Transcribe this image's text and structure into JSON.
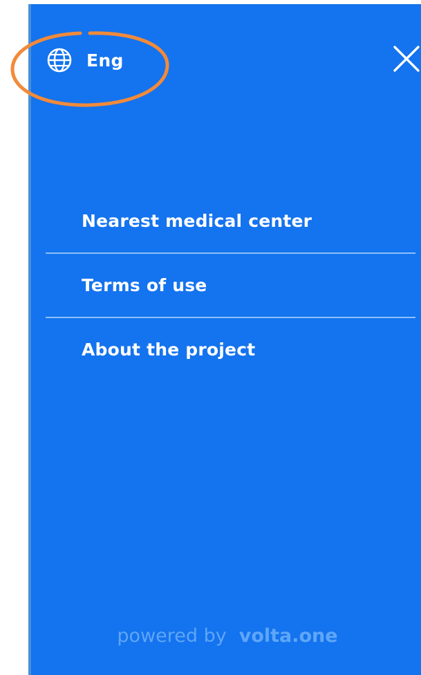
{
  "header": {
    "language_label": "Eng",
    "language_icon": "globe-icon",
    "close_icon": "close-icon"
  },
  "menu": {
    "items": [
      {
        "label": "Nearest medical center"
      },
      {
        "label": "Terms of use"
      },
      {
        "label": "About the project"
      }
    ]
  },
  "footer": {
    "powered_by": "powered by",
    "brand": "volta.one"
  },
  "colors": {
    "panel_background": "#1473ee",
    "divider": "#8cc1f7",
    "footer_text": "#5ea6f8",
    "annotation_circle": "#f28a3a"
  }
}
